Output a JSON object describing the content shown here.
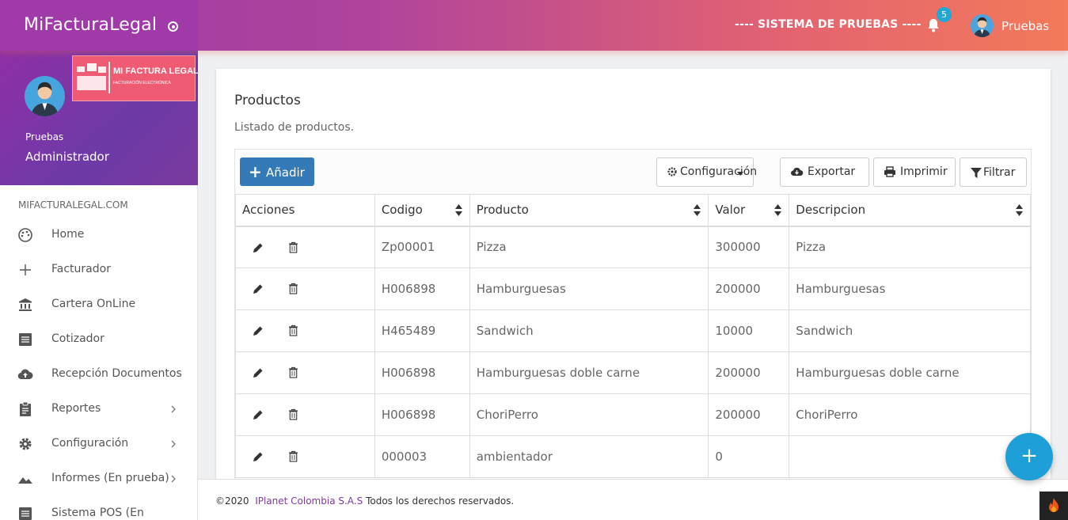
{
  "topbar": {
    "brand": "MiFacturaLegal",
    "system_label": "---- SISTEMA DE PRUEBAS ----",
    "notifications_count": "5",
    "username": "Pruebas"
  },
  "sidebar": {
    "logo_title": "MI FACTURA LEGAL",
    "logo_subtitle": "FACTURACIÓN ELECTRÓNICA",
    "profile_name": "Pruebas",
    "profile_role": "Administrador",
    "section_label": "MIFACTURALEGAL.COM",
    "items": [
      {
        "label": "Home",
        "icon": "palette-icon"
      },
      {
        "label": "Facturador",
        "icon": "plus-icon"
      },
      {
        "label": "Cartera OnLine",
        "icon": "bank-icon"
      },
      {
        "label": "Cotizador",
        "icon": "list-icon"
      },
      {
        "label": "Recepción Documentos",
        "icon": "cloud-upload-icon"
      },
      {
        "label": "Reportes",
        "icon": "clipboard-icon"
      },
      {
        "label": "Configuración",
        "icon": "gear-icon"
      },
      {
        "label": "Informes (En prueba)",
        "icon": "mountain-icon"
      },
      {
        "label": "Sistema POS (En",
        "icon": "list-icon"
      }
    ]
  },
  "main": {
    "title": "Productos",
    "subtitle": "Listado de productos.",
    "toolbar": {
      "add_label": "Añadir",
      "config_label": "Configuración",
      "export_label": "Exportar",
      "print_label": "Imprimir",
      "filter_label": "Filtrar"
    },
    "table": {
      "headers": [
        "Acciones",
        "Codigo",
        "Producto",
        "Valor",
        "Descripcion"
      ],
      "rows": [
        {
          "codigo": "Zp00001",
          "producto": "Pizza",
          "valor": "300000",
          "descripcion": "Pizza"
        },
        {
          "codigo": "H006898",
          "producto": "Hamburguesas",
          "valor": "200000",
          "descripcion": "Hamburguesas"
        },
        {
          "codigo": "H465489",
          "producto": "Sandwich",
          "valor": "10000",
          "descripcion": "Sandwich"
        },
        {
          "codigo": "H006898",
          "producto": "Hamburguesas doble carne",
          "valor": "200000",
          "descripcion": "Hamburguesas doble carne"
        },
        {
          "codigo": "H006898",
          "producto": "ChoriPerro",
          "valor": "200000",
          "descripcion": "ChoriPerro"
        },
        {
          "codigo": "000003",
          "producto": "ambientador",
          "valor": "0",
          "descripcion": ""
        }
      ]
    }
  },
  "footer": {
    "prefix": "©2020",
    "company": "IPlanet Colombia S.A.S",
    "suffix": "Todos los derechos reservados."
  },
  "fab_label": "+",
  "colors": {
    "accent": "#337ab7",
    "brand_purple": "#9c3aa7",
    "brand_coral": "#f37a5a",
    "fab": "#1e9fd8"
  }
}
